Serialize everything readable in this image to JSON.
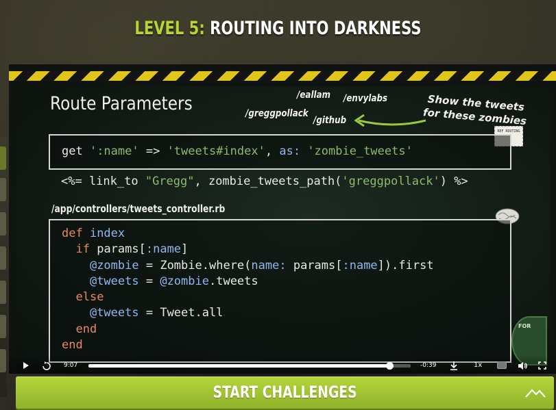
{
  "header": {
    "level_label": "LEVEL 5:",
    "level_name": "ROUTING INTO DARKNESS"
  },
  "slide": {
    "title": "Route Parameters",
    "annotations": {
      "eallam": "/eallam",
      "envylabs": "/envylabs",
      "greggpollack": "/greggpollack",
      "github": "/github",
      "note_line1": "Show the tweets",
      "note_line2": "for these zombies"
    },
    "stamp_text": "REF ROUTING",
    "route_code": {
      "part1": "get ",
      "str1": "':name'",
      "part2": " => ",
      "str2": "'tweets#index'",
      "part3": ", ",
      "sym": "as:",
      "part4": " ",
      "str3": "'zombie_tweets'"
    },
    "erb_code": {
      "part1": "<%= link_to ",
      "str1": "\"Gregg\"",
      "part2": ", zombie_tweets_path(",
      "str2": "'greggpollack'",
      "part3": ") %>"
    },
    "file_path": "/app/controllers/tweets_controller.rb",
    "controller_code": {
      "l1_kw": "def ",
      "l1_fn": "index",
      "l2_kw": "if ",
      "l2_rest": "params[",
      "l2_sym": ":name",
      "l2_end": "]",
      "l3_ivar": "@zombie",
      "l3_eq": " = ",
      "l3_const": "Zombie",
      "l3_mid": ".where(",
      "l3_key": "name:",
      "l3_mid2": " params[",
      "l3_sym": ":name",
      "l3_end": "]).first",
      "l4_ivar": "@tweets",
      "l4_eq": " = ",
      "l4_ivar2": "@zombie",
      "l4_end": ".tweets",
      "l5_kw": "else",
      "l6_ivar": "@tweets",
      "l6_eq": " = ",
      "l6_const": "Tweet",
      "l6_end": ".all",
      "l7_kw": "end",
      "l8_kw": "end"
    },
    "badge_text": "FOR"
  },
  "player": {
    "current_time": "9:07",
    "remaining_time": "-0:39",
    "progress": 0.934,
    "speed": "1x",
    "icons": [
      "play-icon",
      "replay-icon",
      "download-icon",
      "captions-icon",
      "volume-icon",
      "fullscreen-icon"
    ]
  },
  "cta": {
    "label": "START CHALLENGES",
    "color": "#a6c934"
  },
  "colors": {
    "accent_green": "#b8d433",
    "hazard_yellow": "#e0c51a",
    "board_bg": "#111a14"
  }
}
